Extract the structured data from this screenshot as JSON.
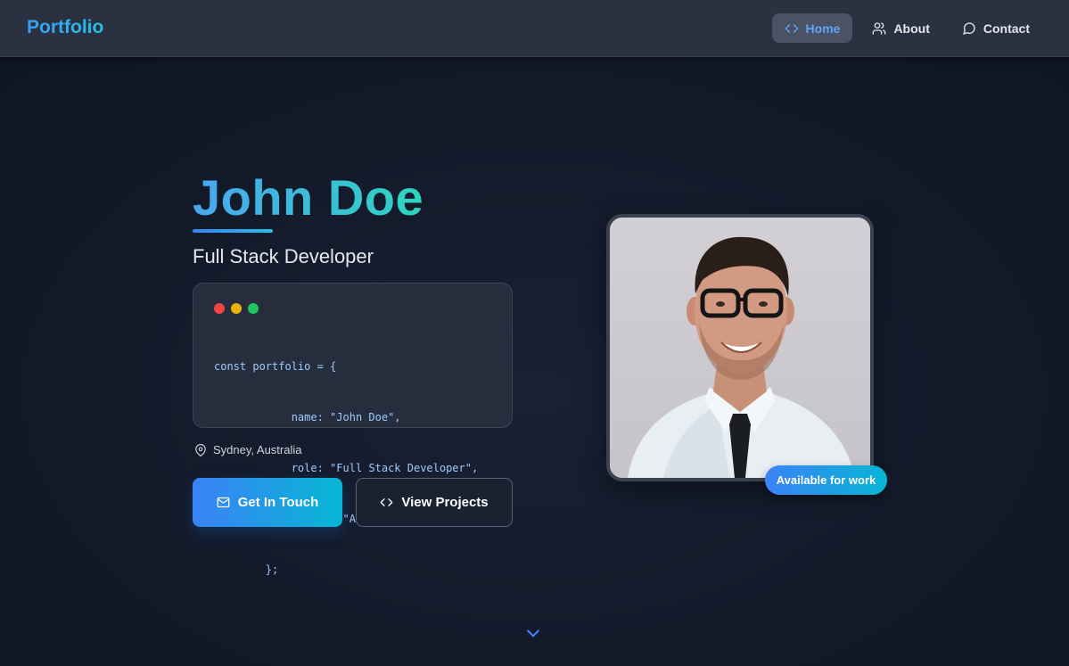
{
  "header": {
    "brand": "Portfolio",
    "nav": [
      {
        "label": "Home",
        "icon": "code-icon",
        "active": true
      },
      {
        "label": "About",
        "icon": "users-icon",
        "active": false
      },
      {
        "label": "Contact",
        "icon": "message-circle-icon",
        "active": false
      }
    ]
  },
  "hero": {
    "name": "John Doe",
    "role": "Full Stack Developer",
    "code": {
      "window_dots": [
        "#ef4444",
        "#eab308",
        "#22c55e"
      ],
      "lines": [
        "const portfolio = {",
        "            name: \"John Doe\",",
        "            role: \"Full Stack Developer\",",
        "            status: \"Active\"",
        "        };"
      ]
    },
    "location": "Sydney, Australia",
    "primary_button": "Get In Touch",
    "secondary_button": "View Projects",
    "badge": "Available for work",
    "scroll_icon": "chevron-down-icon"
  },
  "colors": {
    "background": "#131a2a",
    "header_bg": "#2a3141",
    "accent_blue": "#3b82f6",
    "accent_cyan": "#06b6d4"
  }
}
